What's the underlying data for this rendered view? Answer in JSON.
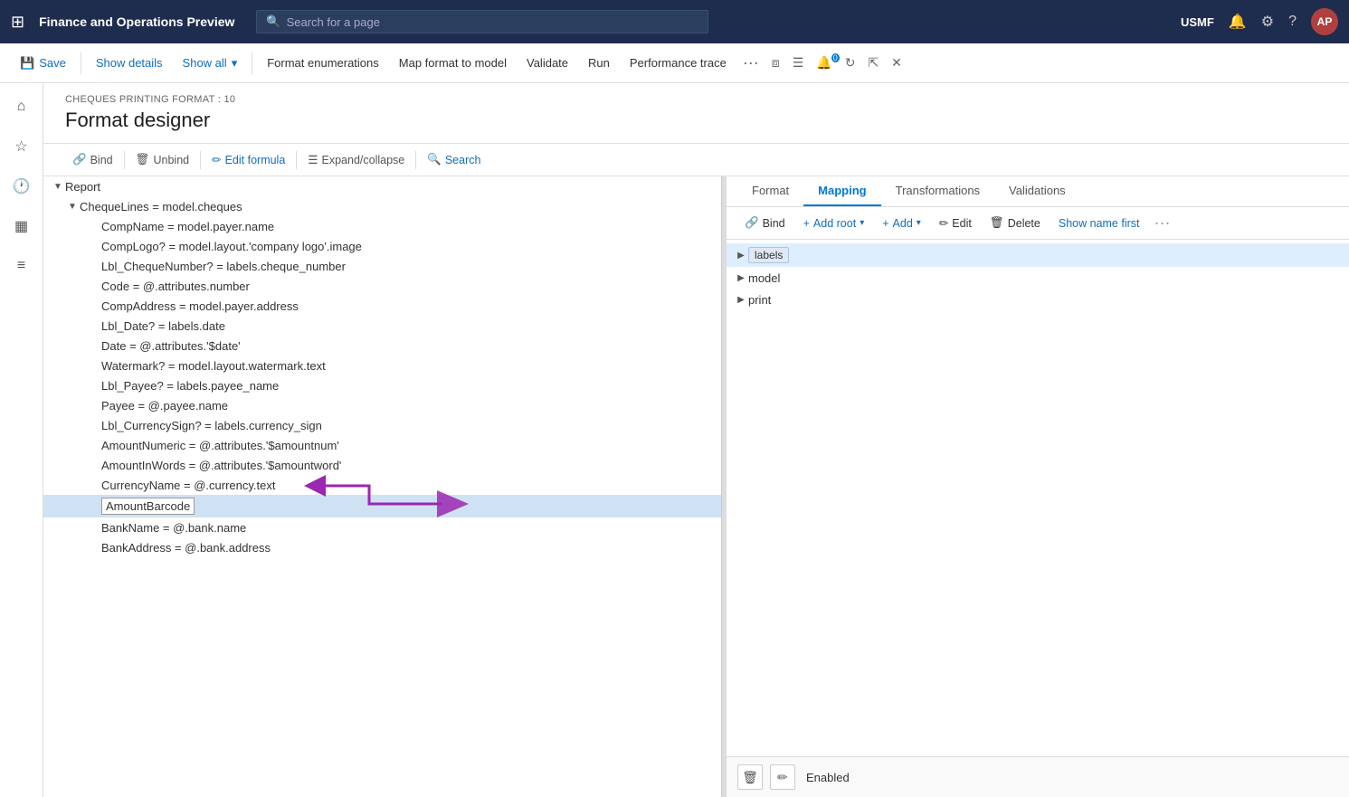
{
  "app": {
    "title": "Finance and Operations Preview",
    "search_placeholder": "Search for a page",
    "user": "USMF",
    "avatar": "AP"
  },
  "toolbar": {
    "save_label": "Save",
    "show_details_label": "Show details",
    "show_all_label": "Show all",
    "format_enumerations_label": "Format enumerations",
    "map_format_to_model_label": "Map format to model",
    "validate_label": "Validate",
    "run_label": "Run",
    "performance_trace_label": "Performance trace"
  },
  "page": {
    "breadcrumb": "CHEQUES PRINTING FORMAT : 10",
    "title": "Format designer"
  },
  "sub_toolbar": {
    "bind_label": "Bind",
    "unbind_label": "Unbind",
    "edit_formula_label": "Edit formula",
    "expand_collapse_label": "Expand/collapse",
    "search_label": "Search"
  },
  "mapping_tabs": {
    "tabs": [
      {
        "id": "format",
        "label": "Format"
      },
      {
        "id": "mapping",
        "label": "Mapping"
      },
      {
        "id": "transformations",
        "label": "Transformations"
      },
      {
        "id": "validations",
        "label": "Validations"
      }
    ],
    "active": "mapping"
  },
  "mapping_toolbar": {
    "bind_label": "Bind",
    "add_root_label": "Add root",
    "add_label": "Add",
    "edit_label": "Edit",
    "delete_label": "Delete",
    "show_name_first_label": "Show name first",
    "more_label": "..."
  },
  "tree": {
    "items": [
      {
        "id": "report",
        "indent": 0,
        "toggle": "▼",
        "label": "Report",
        "selected": false
      },
      {
        "id": "cheque_lines",
        "indent": 1,
        "toggle": "▼",
        "label": "ChequeLines = model.cheques",
        "selected": false
      },
      {
        "id": "comp_name",
        "indent": 2,
        "toggle": "",
        "label": "CompName = model.payer.name",
        "selected": false
      },
      {
        "id": "comp_logo",
        "indent": 2,
        "toggle": "",
        "label": "CompLogo? = model.layout.'company logo'.image",
        "selected": false
      },
      {
        "id": "lbl_cheque_number",
        "indent": 2,
        "toggle": "",
        "label": "Lbl_ChequeNumber? = labels.cheque_number",
        "selected": false
      },
      {
        "id": "code",
        "indent": 2,
        "toggle": "",
        "label": "Code = @.attributes.number",
        "selected": false
      },
      {
        "id": "comp_address",
        "indent": 2,
        "toggle": "",
        "label": "CompAddress = model.payer.address",
        "selected": false
      },
      {
        "id": "lbl_date",
        "indent": 2,
        "toggle": "",
        "label": "Lbl_Date? = labels.date",
        "selected": false
      },
      {
        "id": "date",
        "indent": 2,
        "toggle": "",
        "label": "Date = @.attributes.'$date'",
        "selected": false
      },
      {
        "id": "watermark",
        "indent": 2,
        "toggle": "",
        "label": "Watermark? = model.layout.watermark.text",
        "selected": false
      },
      {
        "id": "lbl_payee",
        "indent": 2,
        "toggle": "",
        "label": "Lbl_Payee? = labels.payee_name",
        "selected": false
      },
      {
        "id": "payee",
        "indent": 2,
        "toggle": "",
        "label": "Payee = @.payee.name",
        "selected": false
      },
      {
        "id": "lbl_currency_sign",
        "indent": 2,
        "toggle": "",
        "label": "Lbl_CurrencySign? = labels.currency_sign",
        "selected": false
      },
      {
        "id": "amount_numeric",
        "indent": 2,
        "toggle": "",
        "label": "AmountNumeric = @.attributes.'$amountnum'",
        "selected": false
      },
      {
        "id": "amount_in_words",
        "indent": 2,
        "toggle": "",
        "label": "AmountInWords = @.attributes.'$amountword'",
        "selected": false
      },
      {
        "id": "currency_name",
        "indent": 2,
        "toggle": "",
        "label": "CurrencyName = @.currency.text",
        "selected": false
      },
      {
        "id": "amount_barcode",
        "indent": 2,
        "toggle": "",
        "label": "AmountBarcode",
        "selected": true
      },
      {
        "id": "bank_name",
        "indent": 2,
        "toggle": "",
        "label": "BankName = @.bank.name",
        "selected": false
      },
      {
        "id": "bank_address",
        "indent": 2,
        "toggle": "",
        "label": "BankAddress = @.bank.address",
        "selected": false
      }
    ]
  },
  "mapping_tree": {
    "items": [
      {
        "id": "labels",
        "indent": 0,
        "toggle": "▶",
        "label": "labels",
        "type": "node",
        "selected": true
      },
      {
        "id": "model",
        "indent": 0,
        "toggle": "▶",
        "label": "model",
        "type": "plain",
        "selected": false
      },
      {
        "id": "print",
        "indent": 0,
        "toggle": "▶",
        "label": "print",
        "type": "plain",
        "selected": false
      }
    ]
  },
  "footer": {
    "status_label": "Enabled",
    "delete_icon": "🗑",
    "edit_icon": "✏"
  }
}
